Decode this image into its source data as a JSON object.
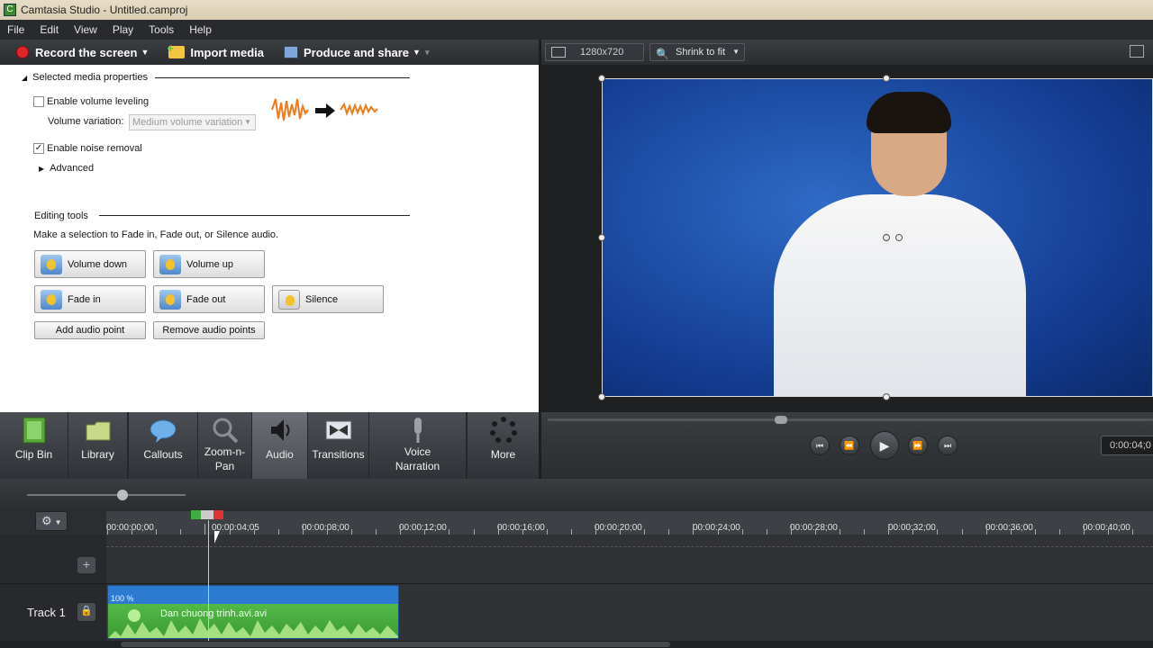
{
  "window": {
    "title": "Camtasia Studio - Untitled.camproj"
  },
  "menu": [
    "File",
    "Edit",
    "View",
    "Play",
    "Tools",
    "Help"
  ],
  "toolbar": {
    "record": "Record the screen",
    "import": "Import media",
    "produce": "Produce and share"
  },
  "properties": {
    "section_title": "Selected media properties",
    "volume_leveling": {
      "label": "Enable volume leveling",
      "checked": false
    },
    "volume_variation": {
      "label": "Volume variation:",
      "value": "Medium volume variation"
    },
    "noise_removal": {
      "label": "Enable noise removal",
      "checked": true
    },
    "advanced": "Advanced",
    "editing_title": "Editing tools",
    "editing_hint": "Make a selection to Fade in, Fade out, or Silence audio.",
    "buttons": {
      "volume_down": "Volume down",
      "volume_up": "Volume up",
      "fade_in": "Fade in",
      "fade_out": "Fade out",
      "silence": "Silence",
      "add_point": "Add audio point",
      "remove_points": "Remove audio points"
    }
  },
  "tasks": [
    "Clip Bin",
    "Library",
    "Callouts",
    "Zoom-n-\nPan",
    "Audio",
    "Transitions",
    "Voice\nNarration",
    "More"
  ],
  "preview": {
    "dimensions": "1280x720",
    "zoom": "Shrink to fit",
    "time": "0:00:04;0"
  },
  "timeline": {
    "ruler": [
      "00:00:00;00",
      "00:00:04;05",
      "00:00:08;00",
      "00:00:12;00",
      "00:00:16;00",
      "00:00:20;00",
      "00:00:24;00",
      "00:00:28;00",
      "00:00:32;00",
      "00:00:36;00",
      "00:00:40;00"
    ],
    "track_label": "Track 1",
    "clip": {
      "name": "Dan chuong trinh.avi.avi",
      "volume": "100 %"
    }
  }
}
